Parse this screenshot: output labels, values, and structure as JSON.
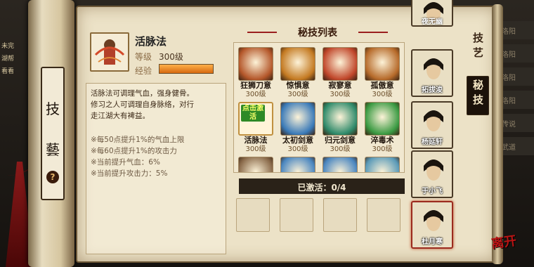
{
  "background": {
    "left_texts": [
      "未完",
      "湖帮",
      "看看"
    ],
    "right_items": [
      "洛阳",
      "洛阳",
      "洛阳",
      "洛阳",
      "传说",
      "武道"
    ]
  },
  "side_tab": {
    "chars": [
      "技",
      "藝"
    ],
    "help": "?"
  },
  "skill": {
    "name": "活脉法",
    "level_label": "等级",
    "level_value": "300级",
    "exp_label": "经验",
    "exp_fraction": 1.0,
    "description": [
      "活脉法可调理气血，强身健骨。",
      "修习之人可调理自身脉络，对行",
      "走江湖大有裨益。"
    ],
    "effects": [
      "※每50点提升1%的气血上限",
      "※每60点提升1%的攻击力",
      "※当前提升气血：6%",
      "※当前提升攻击力：5%"
    ]
  },
  "secret_list": {
    "title": "秘技列表",
    "skills": [
      {
        "name": "狂狮刀意",
        "level": "300级",
        "color": "#b4572a"
      },
      {
        "name": "惊惧意",
        "level": "300级",
        "color": "#c47a22"
      },
      {
        "name": "寂寥意",
        "level": "300级",
        "color": "#c0462a"
      },
      {
        "name": "孤傲意",
        "level": "300级",
        "color": "#b66a2a"
      },
      {
        "name": "活脉法",
        "level": "300级",
        "color": "#c06a3a",
        "tag": "点击激活",
        "selected": true
      },
      {
        "name": "太初剑意",
        "level": "300级",
        "color": "#3a7ab8"
      },
      {
        "name": "归元剑意",
        "level": "300级",
        "color": "#2e8a6a"
      },
      {
        "name": "淬毒术",
        "level": "300级",
        "color": "#3a9a42"
      },
      {
        "name": "",
        "level": "",
        "color": "#8a6a4a"
      },
      {
        "name": "",
        "level": "",
        "color": "#4a86c0"
      },
      {
        "name": "",
        "level": "",
        "color": "#4a86c0"
      },
      {
        "name": "",
        "level": "",
        "color": "#5a9ab8"
      }
    ],
    "activated_label": "已激活：0/4"
  },
  "characters": [
    {
      "name": "夜无幽",
      "active": false
    },
    {
      "name": "拓拔浚",
      "active": false
    },
    {
      "name": "杨延轩",
      "active": false
    },
    {
      "name": "于小飞",
      "active": false
    },
    {
      "name": "杜月寒",
      "active": true
    }
  ],
  "right_tabs": [
    {
      "label": "技艺",
      "active": false
    },
    {
      "label": "秘技",
      "active": true
    }
  ],
  "logo_text": "离开"
}
